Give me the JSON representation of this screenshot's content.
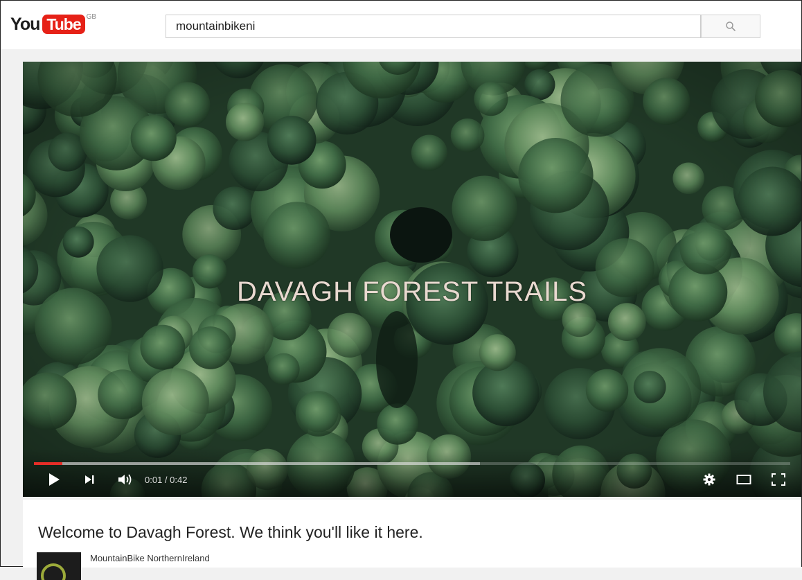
{
  "logo": {
    "you": "You",
    "tube": "Tube",
    "region": "GB"
  },
  "search": {
    "query": "mountainbikeni"
  },
  "icons": {
    "search": "search-icon",
    "play": "play-icon",
    "next": "next-icon",
    "volume": "volume-icon",
    "settings": "gear-icon",
    "theater": "theater-mode-icon",
    "fullscreen": "fullscreen-icon"
  },
  "player": {
    "overlay_title": "DAVAGH FOREST TRAILS",
    "time": "0:01 / 0:42",
    "progress_played": 0.038,
    "progress_buffered": 0.59
  },
  "video": {
    "title": "Welcome to Davagh Forest. We think you'll like it here.",
    "channel": "MountainBike NorthernIreland"
  },
  "colors": {
    "brand_red": "#e62117",
    "progress_red": "#e52d27"
  }
}
